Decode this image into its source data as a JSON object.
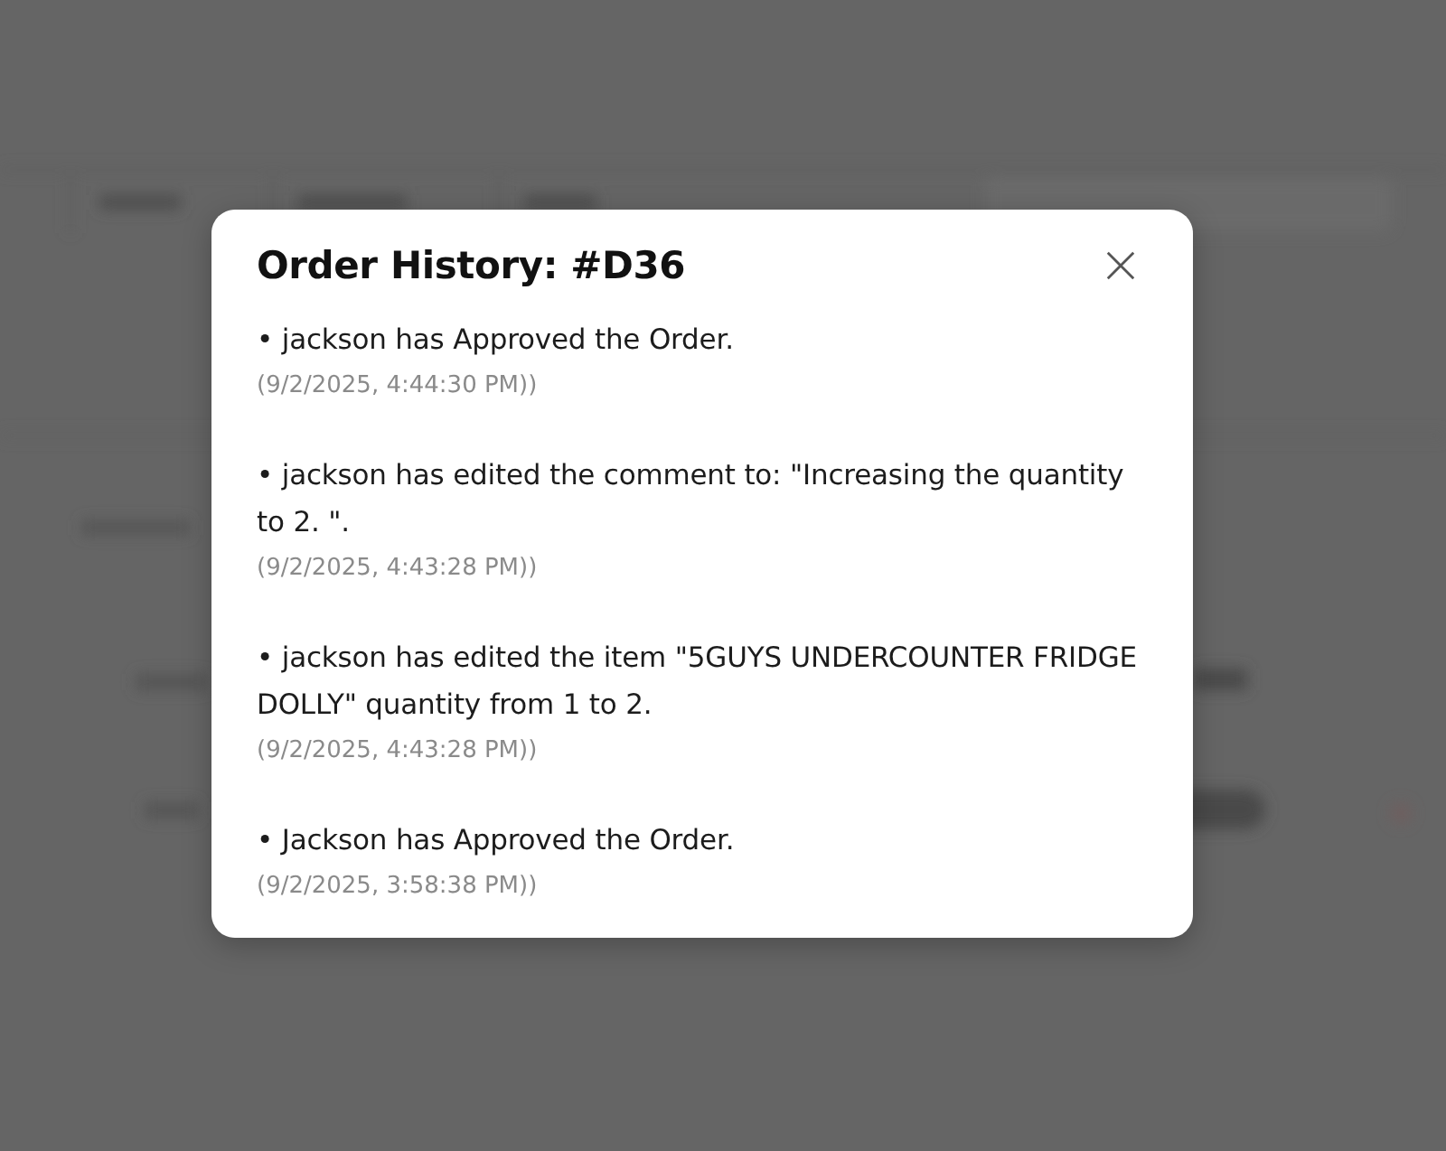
{
  "dialog": {
    "title": "Order History: #D36",
    "entries": [
      {
        "text": "• jackson has Approved the Order.",
        "timestamp": "(9/2/2025, 4:44:30 PM))"
      },
      {
        "text": "• jackson has edited the comment to: \"Increasing the quantity to 2. \".",
        "timestamp": "(9/2/2025, 4:43:28 PM))"
      },
      {
        "text": "• jackson has edited the item \"5GUYS UNDERCOUNTER FRIDGE DOLLY\" quantity from 1 to 2.",
        "timestamp": "(9/2/2025, 4:43:28 PM))"
      },
      {
        "text": "• Jackson has Approved the Order.",
        "timestamp": "(9/2/2025, 3:58:38 PM))"
      }
    ]
  }
}
